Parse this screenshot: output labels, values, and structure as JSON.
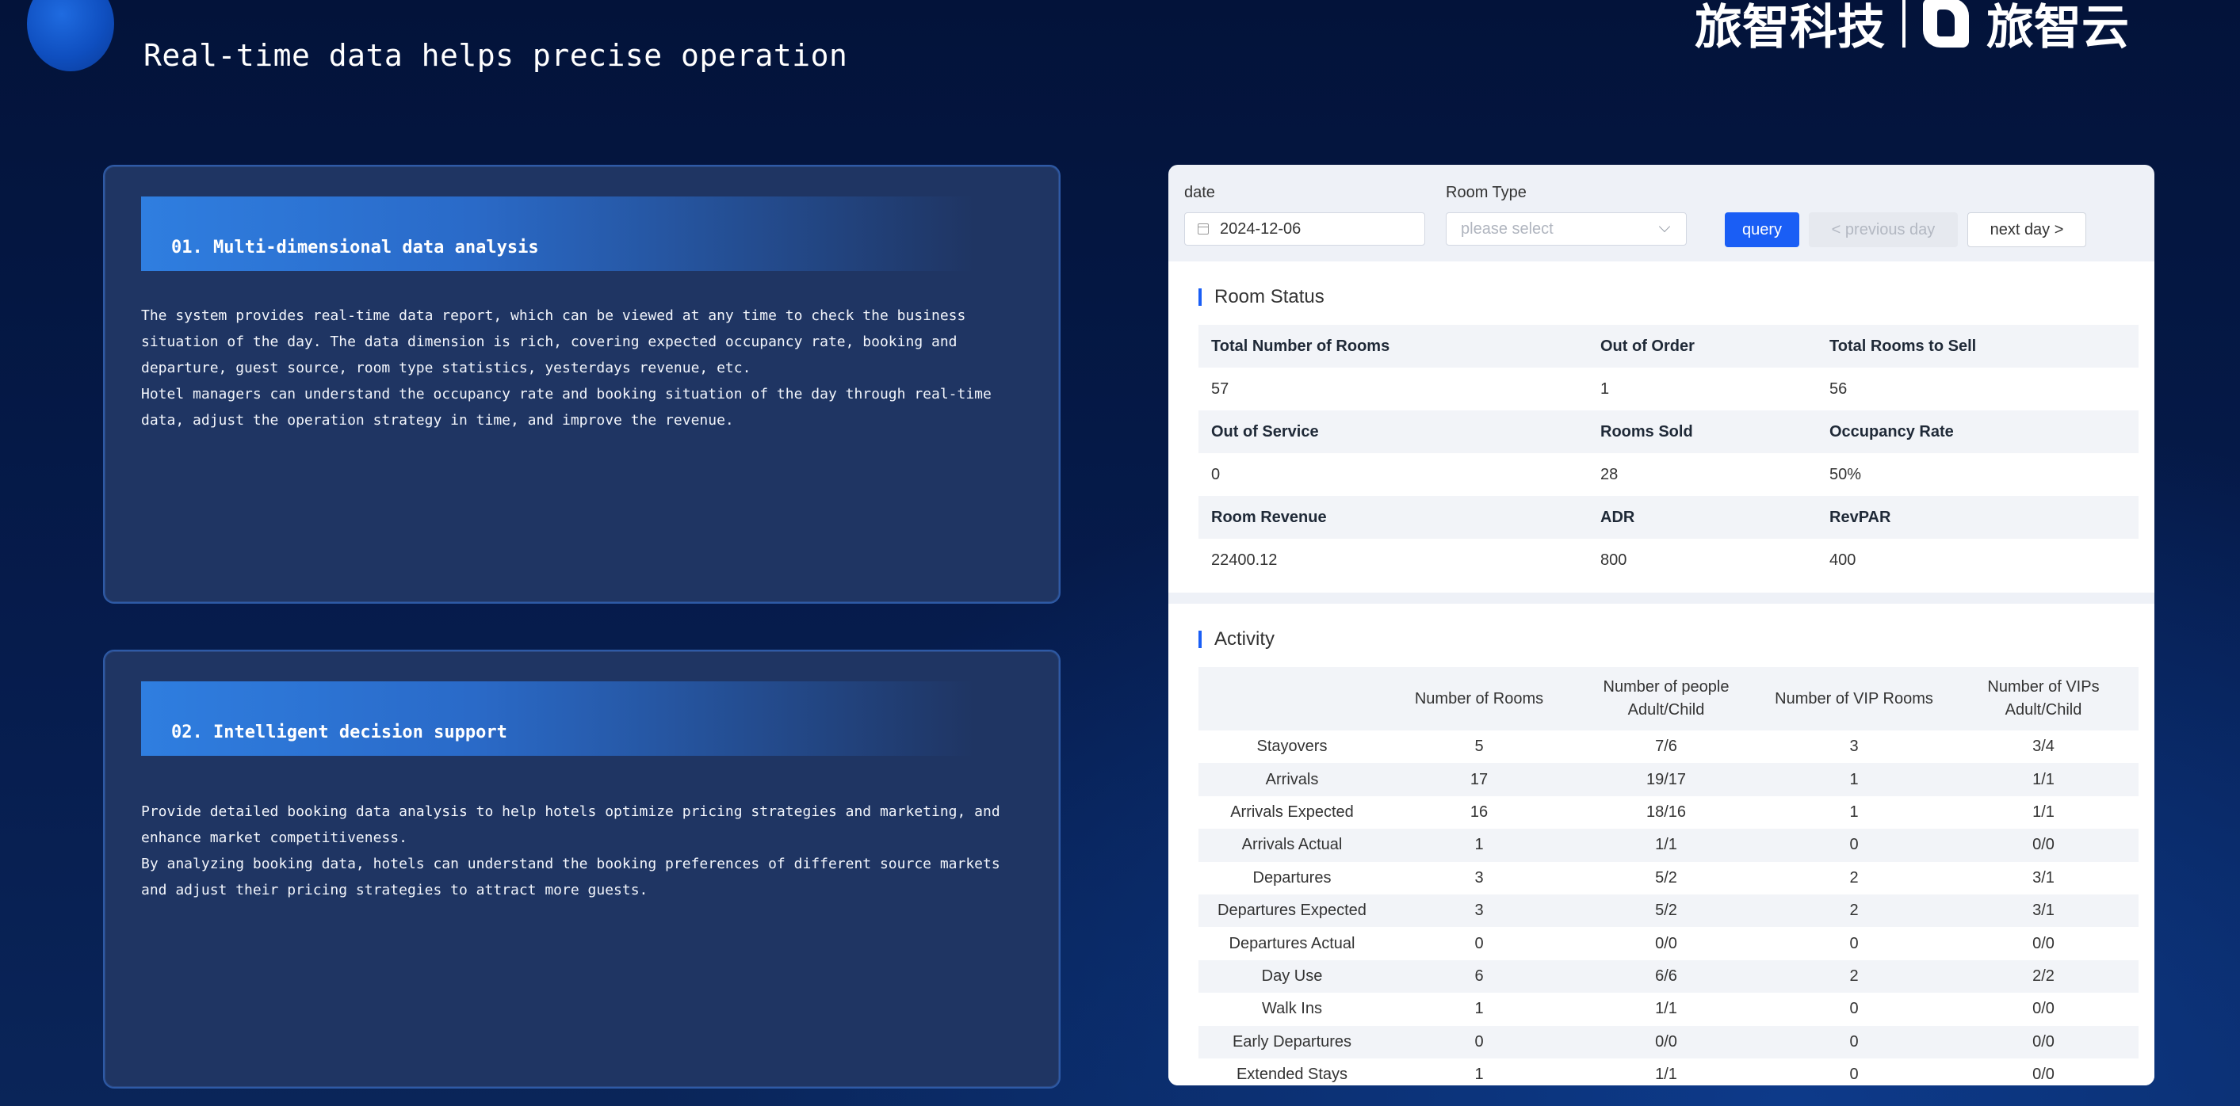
{
  "header": {
    "title": "Real-time data helps precise operation",
    "logo_cn": "旅智科技",
    "logo_cloud": "旅智云"
  },
  "features": [
    {
      "heading": "01. Multi-dimensional data analysis",
      "paragraphs": [
        "The system provides real-time data report, which can be viewed at any time to check the business situation of the day. The data dimension is rich, covering expected occupancy rate, booking and departure, guest source, room type statistics, yesterdays revenue, etc.",
        "Hotel managers can understand the occupancy rate and booking situation of the day through real-time data, adjust the operation strategy in time, and improve the revenue."
      ]
    },
    {
      "heading": "02. Intelligent decision support",
      "paragraphs": [
        "Provide detailed booking data analysis to help hotels optimize pricing strategies and marketing, and enhance market competitiveness.",
        "By analyzing booking data, hotels can understand the booking preferences of different source markets and adjust their pricing strategies to attract more guests."
      ]
    }
  ],
  "filters": {
    "date_label": "date",
    "date_value": "2024-12-06",
    "room_type_label": "Room Type",
    "room_type_placeholder": "please select",
    "query_label": "query",
    "prev_label": "< previous day",
    "next_label": "next day >"
  },
  "room_status": {
    "title": "Room Status",
    "rows": [
      {
        "labels": [
          "Total Number of Rooms",
          "Out of Order",
          "Total Rooms to Sell"
        ],
        "values": [
          "57",
          "1",
          "56"
        ]
      },
      {
        "labels": [
          "Out of Service",
          "Rooms Sold",
          "Occupancy Rate"
        ],
        "values": [
          "0",
          "28",
          "50%"
        ]
      },
      {
        "labels": [
          "Room Revenue",
          "ADR",
          "RevPAR"
        ],
        "values": [
          "22400.12",
          "800",
          "400"
        ]
      }
    ]
  },
  "activity": {
    "title": "Activity",
    "columns": [
      "",
      "Number of Rooms",
      "Number of people Adult/Child",
      "Number of VIP Rooms",
      "Number of VIPs Adult/Child"
    ],
    "rows": [
      [
        "Stayovers",
        "5",
        "7/6",
        "3",
        "3/4"
      ],
      [
        "Arrivals",
        "17",
        "19/17",
        "1",
        "1/1"
      ],
      [
        "Arrivals Expected",
        "16",
        "18/16",
        "1",
        "1/1"
      ],
      [
        "Arrivals Actual",
        "1",
        "1/1",
        "0",
        "0/0"
      ],
      [
        "Departures",
        "3",
        "5/2",
        "2",
        "3/1"
      ],
      [
        "Departures Expected",
        "3",
        "5/2",
        "2",
        "3/1"
      ],
      [
        "Departures Actual",
        "0",
        "0/0",
        "0",
        "0/0"
      ],
      [
        "Day Use",
        "6",
        "6/6",
        "2",
        "2/2"
      ],
      [
        "Walk Ins",
        "1",
        "1/1",
        "0",
        "0/0"
      ],
      [
        "Early Departures",
        "0",
        "0/0",
        "0",
        "0/0"
      ],
      [
        "Extended Stays",
        "1",
        "1/1",
        "0",
        "0/0"
      ]
    ]
  }
}
